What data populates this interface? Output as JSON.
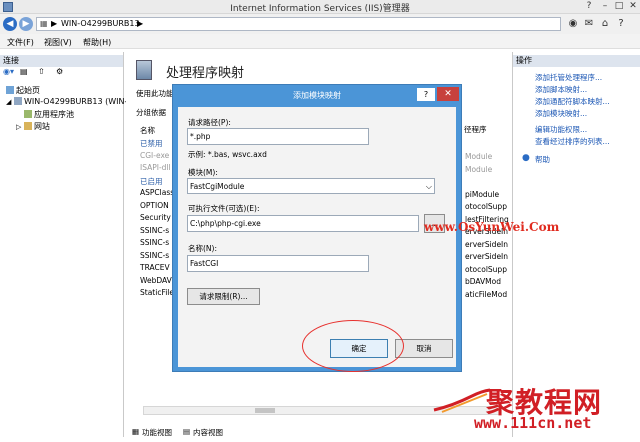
{
  "window": {
    "title": "Internet Information Services (IIS)管理器"
  },
  "address": {
    "root": "WIN-O4299BURB13",
    "separator": "▶"
  },
  "menu": [
    "文件(F)",
    "视图(V)",
    "帮助(H)"
  ],
  "connections": {
    "header": "连接",
    "tree": [
      "起始页",
      "WIN-O4299BURB13 (WIN-",
      "应用程序池",
      "网站"
    ]
  },
  "main": {
    "title": "处理程序映射",
    "use_text": "使用此功能",
    "group_by": "分组依据",
    "col_name": "名称",
    "col_right": "径程序",
    "rows_left": [
      {
        "text": "已禁用",
        "kind": "grp"
      },
      {
        "text": "CGI-exe",
        "kind": "dim"
      },
      {
        "text": "ISAPI-dll",
        "kind": "dim"
      },
      {
        "text": "已启用",
        "kind": "grp"
      },
      {
        "text": "ASPClass",
        "kind": ""
      },
      {
        "text": "OPTION",
        "kind": ""
      },
      {
        "text": "Security",
        "kind": ""
      },
      {
        "text": "SSINC-s",
        "kind": ""
      },
      {
        "text": "SSINC-s",
        "kind": ""
      },
      {
        "text": "SSINC-s",
        "kind": ""
      },
      {
        "text": "TRACEV",
        "kind": ""
      },
      {
        "text": "WebDAV",
        "kind": ""
      },
      {
        "text": "StaticFile",
        "kind": ""
      }
    ],
    "rows_right": [
      {
        "text": "Module",
        "kind": "dim"
      },
      {
        "text": "Module",
        "kind": "dim"
      },
      {
        "text": "",
        "kind": ""
      },
      {
        "text": "piModule",
        "kind": ""
      },
      {
        "text": "otocolSupp",
        "kind": ""
      },
      {
        "text": "lestFiltering",
        "kind": ""
      },
      {
        "text": "erverSideIn",
        "kind": ""
      },
      {
        "text": "erverSideIn",
        "kind": ""
      },
      {
        "text": "erverSideIn",
        "kind": ""
      },
      {
        "text": "otocolSupp",
        "kind": ""
      },
      {
        "text": "bDAVMod",
        "kind": ""
      },
      {
        "text": "aticFileMod",
        "kind": ""
      }
    ],
    "tabs": [
      "功能视图",
      "内容视图"
    ]
  },
  "actions": {
    "header": "操作",
    "items": [
      "添加托管处理程序...",
      "添加脚本映射...",
      "添加通配符脚本映射...",
      "添加模块映射...",
      "编辑功能权限...",
      "查看经过排序的列表...",
      "帮助"
    ]
  },
  "dialog": {
    "title": "添加模块映射",
    "help": "?",
    "close": "✕",
    "request_path_label": "请求路径(P):",
    "request_path_value": "*.php",
    "example": "示例: *.bas, wsvc.axd",
    "module_label": "模块(M):",
    "module_value": "FastCgiModule",
    "exe_label": "可执行文件(可选)(E):",
    "exe_value": "C:\\php\\php-cgi.exe",
    "browse_label": "...",
    "name_label": "名称(N):",
    "name_value": "FastCGI",
    "restrict_label": "请求限制(R)...",
    "ok_label": "确定",
    "cancel_label": "取消"
  },
  "watermark": {
    "url": "www.OsYunWei.Com"
  },
  "brand": {
    "name": "聚教程网",
    "sub": "www.111cn.net"
  },
  "colors": {
    "dialog_frame": "#4b95d7",
    "close": "#c7413d",
    "link": "#1a56b4",
    "highlight": "#e7312e"
  }
}
